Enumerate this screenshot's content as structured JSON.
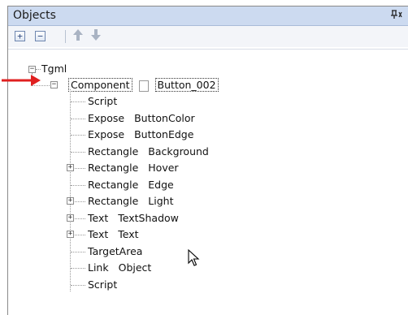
{
  "window": {
    "title": "Objects",
    "pin_glyph": "ꟷ",
    "close_glyph": "✕"
  },
  "toolbar": {
    "expand_glyph": "+",
    "collapse_glyph": "−",
    "up_glyph": "⇧",
    "down_glyph": "⇩"
  },
  "tree": {
    "root": {
      "label": "Tgml",
      "expander": "−"
    },
    "component": {
      "label": "Component",
      "value": "Button_002",
      "expander": "−"
    },
    "children": [
      {
        "type": "Script",
        "name": "",
        "expander": ""
      },
      {
        "type": "Expose",
        "name": "ButtonColor",
        "expander": ""
      },
      {
        "type": "Expose",
        "name": "ButtonEdge",
        "expander": ""
      },
      {
        "type": "Rectangle",
        "name": "Background",
        "expander": ""
      },
      {
        "type": "Rectangle",
        "name": "Hover",
        "expander": "+"
      },
      {
        "type": "Rectangle",
        "name": "Edge",
        "expander": ""
      },
      {
        "type": "Rectangle",
        "name": "Light",
        "expander": "+"
      },
      {
        "type": "Text",
        "name": "TextShadow",
        "expander": "+"
      },
      {
        "type": "Text",
        "name": "Text",
        "expander": "+"
      },
      {
        "type": "TargetArea",
        "name": "",
        "expander": ""
      },
      {
        "type": "Link",
        "name": "Object",
        "expander": ""
      },
      {
        "type": "Script",
        "name": "",
        "expander": ""
      }
    ]
  },
  "colors": {
    "titlebar": "#ccdaf0",
    "annotation_arrow": "#e02020"
  }
}
